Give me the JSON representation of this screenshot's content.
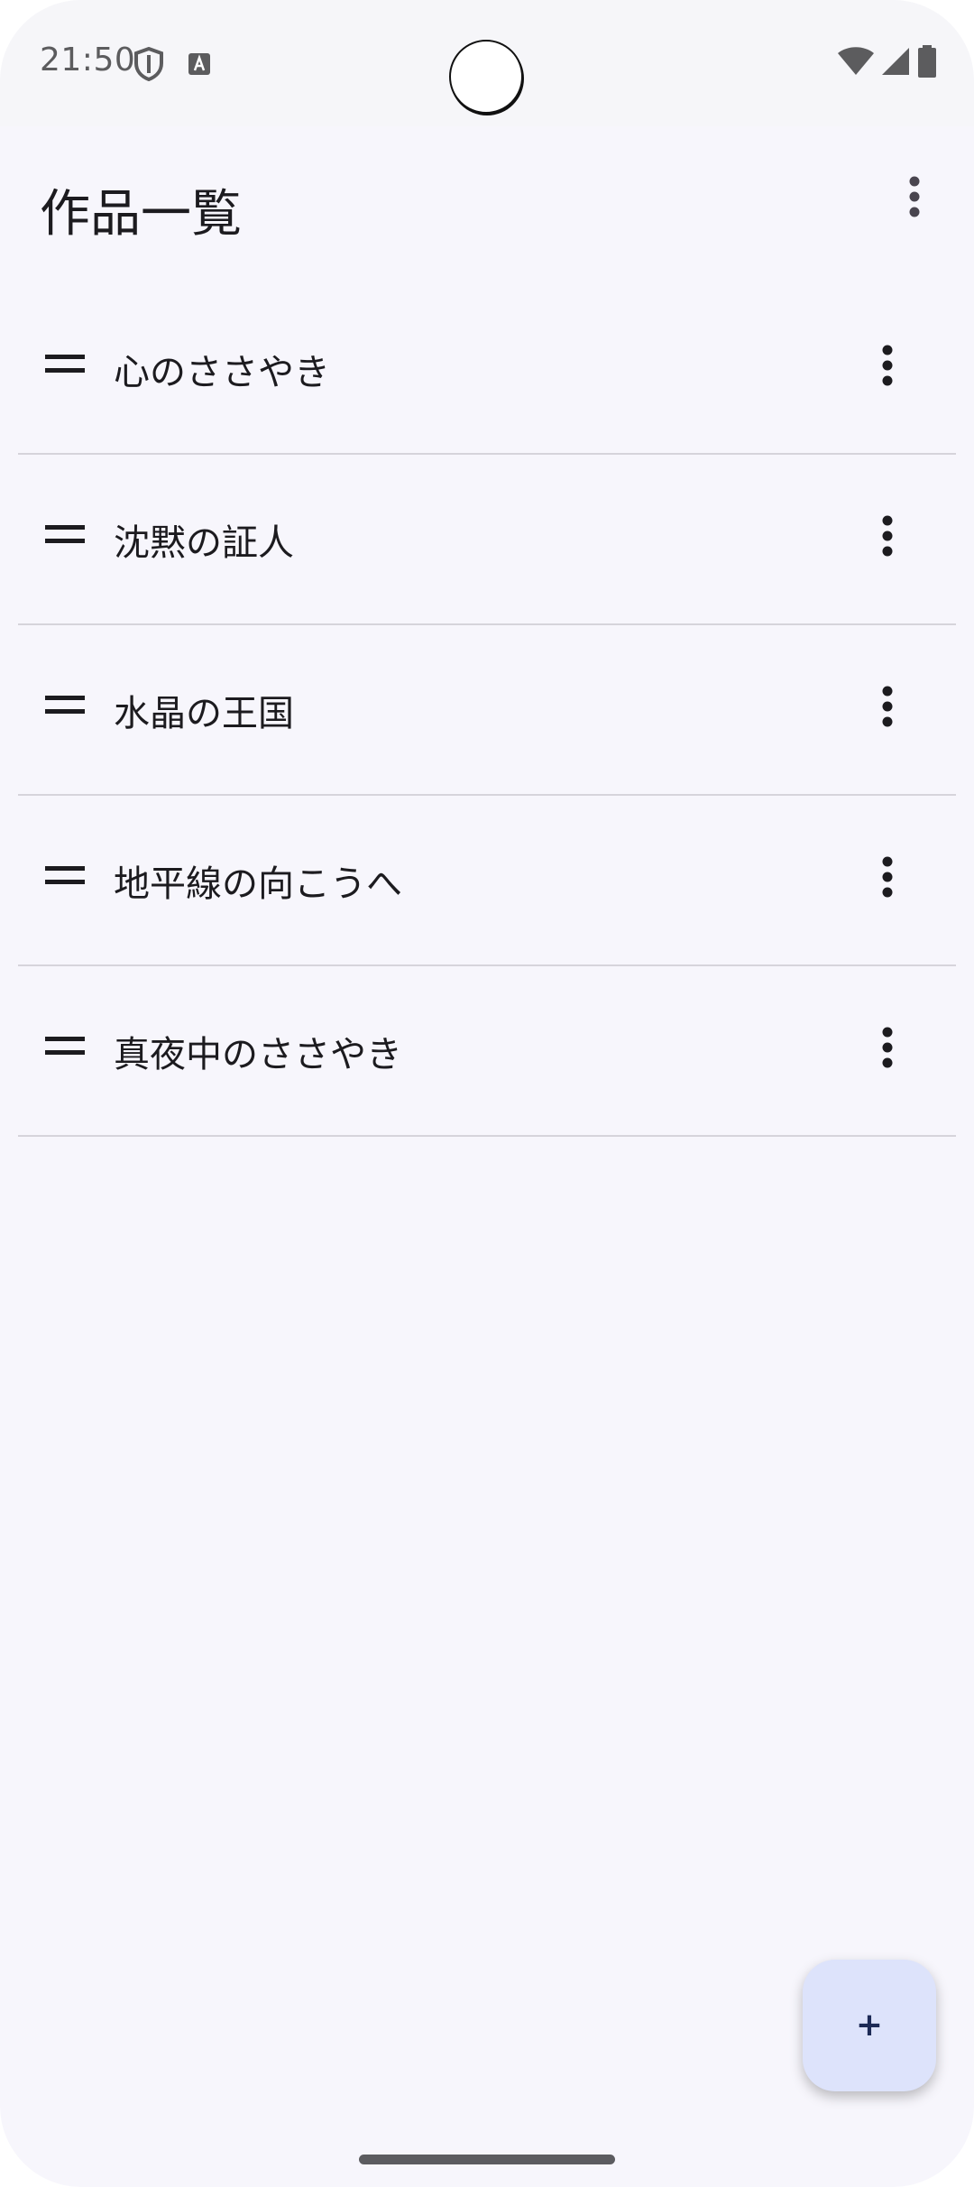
{
  "status_bar": {
    "time": "21:50",
    "icons": [
      "shield-icon",
      "a-badge-icon",
      "wifi-icon",
      "signal-icon",
      "battery-icon"
    ]
  },
  "app_bar": {
    "title": "作品一覧",
    "overflow_icon": "more-vert-icon"
  },
  "works": [
    {
      "title": "心のささやき"
    },
    {
      "title": "沈黙の証人"
    },
    {
      "title": "水晶の王国"
    },
    {
      "title": "地平線の向こうへ"
    },
    {
      "title": "真夜中のささやき"
    }
  ],
  "fab": {
    "label": "+"
  },
  "colors": {
    "background": "#f7f6fc",
    "fab": "#dde3fb",
    "text": "#1c1b1f",
    "divider": "#d6d4db"
  }
}
